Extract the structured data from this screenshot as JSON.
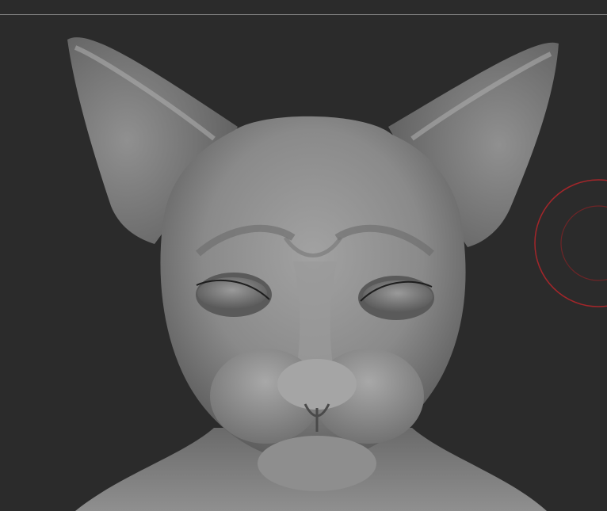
{
  "app": {
    "kind": "3d-sculpt-viewport",
    "background": "#2b2b2b"
  },
  "viewport": {
    "model": {
      "subject": "cat-head-sculpt",
      "base_color": "#8d8d8d"
    },
    "brush_cursor": {
      "icon": "brush-circle-cursor",
      "color": "#a3262a"
    }
  }
}
